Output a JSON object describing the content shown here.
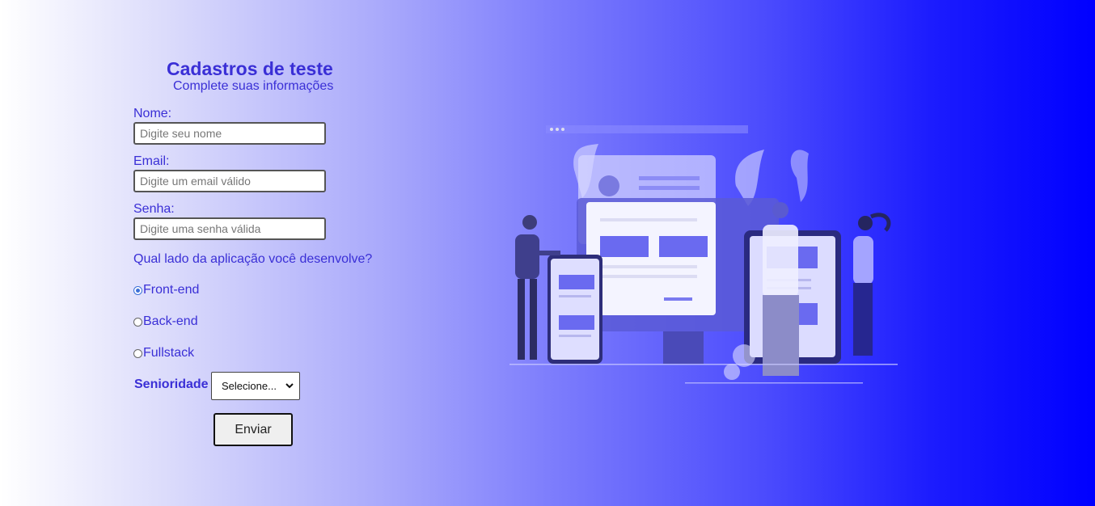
{
  "form": {
    "title": "Cadastros de teste",
    "subtitle": "Complete suas informações",
    "name_label": "Nome:",
    "name_placeholder": "Digite seu nome",
    "email_label": "Email:",
    "email_placeholder": "Digite um email válido",
    "password_label": "Senha:",
    "password_placeholder": "Digite uma senha válida",
    "question": "Qual lado da aplicação você desenvolve?",
    "options": [
      {
        "label": "Front-end",
        "checked": true
      },
      {
        "label": "Back-end",
        "checked": false
      },
      {
        "label": "Fullstack",
        "checked": false
      }
    ],
    "seniority_label": "Senioridade",
    "seniority_value": "Selecione...",
    "submit_label": "Enviar"
  },
  "colors": {
    "accent": "#3a2fd6",
    "gradient_end": "#0000ff"
  }
}
